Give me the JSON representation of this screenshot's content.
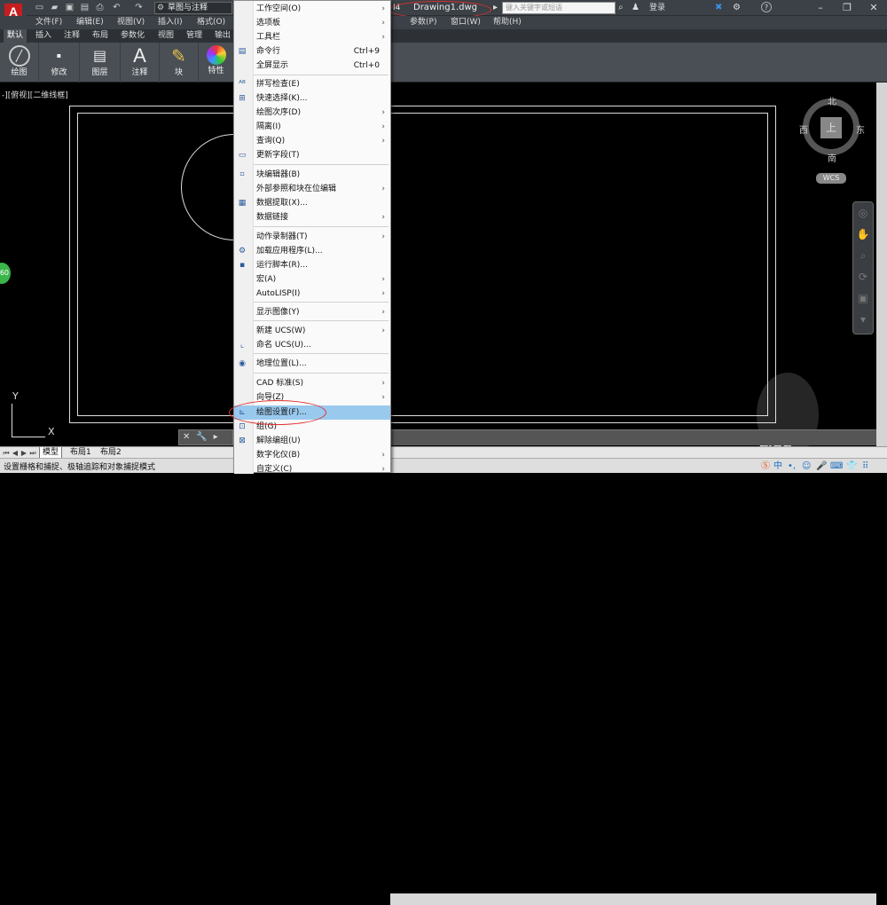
{
  "title_bar": {
    "app_logo": "A",
    "workspace": "草图与注释",
    "doc_number": "I4",
    "doc_title": "Drawing1.dwg",
    "search_placeholder": "键入关键字或短语",
    "login": "登录",
    "help_icon": "?"
  },
  "menubar": {
    "items": [
      "文件(F)",
      "编辑(E)",
      "视图(V)",
      "插入(I)",
      "格式(O)",
      "参数(P)",
      "窗口(W)",
      "帮助(H)"
    ]
  },
  "ribbon_tabs": [
    "默认",
    "插入",
    "注释",
    "布局",
    "参数化",
    "视图",
    "管理",
    "输出"
  ],
  "ribbon_buttons": [
    {
      "label": "绘图",
      "icon": "draw-icon"
    },
    {
      "label": "修改",
      "icon": "modify-icon"
    },
    {
      "label": "图层",
      "icon": "layer-icon"
    },
    {
      "label": "注释",
      "icon": "annotation-icon"
    },
    {
      "label": "块",
      "icon": "block-icon"
    },
    {
      "label": "特性",
      "icon": "properties-icon"
    }
  ],
  "viewport_label": "-][俯视][二维线框]",
  "viewcube": {
    "north": "北",
    "south": "南",
    "east": "东",
    "west": "西",
    "top": "上",
    "wcs": "WCS"
  },
  "ucs": {
    "x": "X",
    "y": "Y"
  },
  "green_badge": "60",
  "watermark": "aidu",
  "layout_tabs": [
    "模型",
    "布局1",
    "布局2"
  ],
  "status_text": "设置栅格和捕捉、极轴追踪和对象捕捉模式",
  "tray_text": "中",
  "tools_menu": {
    "items": [
      {
        "label": "工作空间(O)",
        "shortcut": "",
        "submenu": true,
        "icon": ""
      },
      {
        "label": "选项板",
        "shortcut": "",
        "submenu": true,
        "icon": ""
      },
      {
        "label": "工具栏",
        "shortcut": "",
        "submenu": true,
        "icon": ""
      },
      {
        "label": "命令行",
        "shortcut": "Ctrl+9",
        "submenu": false,
        "icon": "command-line-icon"
      },
      {
        "label": "全屏显示",
        "shortcut": "Ctrl+0",
        "submenu": false,
        "icon": ""
      },
      {
        "label": "拼写检查(E)",
        "shortcut": "",
        "submenu": false,
        "icon": "spellcheck-icon"
      },
      {
        "label": "快速选择(K)...",
        "shortcut": "",
        "submenu": false,
        "icon": "quick-select-icon"
      },
      {
        "label": "绘图次序(D)",
        "shortcut": "",
        "submenu": true,
        "icon": ""
      },
      {
        "label": "隔离(I)",
        "shortcut": "",
        "submenu": true,
        "icon": ""
      },
      {
        "label": "查询(Q)",
        "shortcut": "",
        "submenu": true,
        "icon": ""
      },
      {
        "label": "更新字段(T)",
        "shortcut": "",
        "submenu": false,
        "icon": "update-field-icon"
      },
      {
        "label": "块编辑器(B)",
        "shortcut": "",
        "submenu": false,
        "icon": "block-editor-icon"
      },
      {
        "label": "外部参照和块在位编辑",
        "shortcut": "",
        "submenu": true,
        "icon": ""
      },
      {
        "label": "数据提取(X)...",
        "shortcut": "",
        "submenu": false,
        "icon": "data-extract-icon"
      },
      {
        "label": "数据链接",
        "shortcut": "",
        "submenu": true,
        "icon": ""
      },
      {
        "label": "动作录制器(T)",
        "shortcut": "",
        "submenu": true,
        "icon": ""
      },
      {
        "label": "加载应用程序(L)...",
        "shortcut": "",
        "submenu": false,
        "icon": "load-app-icon"
      },
      {
        "label": "运行脚本(R)...",
        "shortcut": "",
        "submenu": false,
        "icon": "run-script-icon"
      },
      {
        "label": "宏(A)",
        "shortcut": "",
        "submenu": true,
        "icon": ""
      },
      {
        "label": "AutoLISP(I)",
        "shortcut": "",
        "submenu": true,
        "icon": ""
      },
      {
        "label": "显示图像(Y)",
        "shortcut": "",
        "submenu": true,
        "icon": ""
      },
      {
        "label": "新建 UCS(W)",
        "shortcut": "",
        "submenu": true,
        "icon": ""
      },
      {
        "label": "命名 UCS(U)...",
        "shortcut": "",
        "submenu": false,
        "icon": "named-ucs-icon"
      },
      {
        "label": "地理位置(L)...",
        "shortcut": "",
        "submenu": false,
        "icon": "geolocation-icon"
      },
      {
        "label": "CAD 标准(S)",
        "shortcut": "",
        "submenu": true,
        "icon": ""
      },
      {
        "label": "向导(Z)",
        "shortcut": "",
        "submenu": true,
        "icon": ""
      },
      {
        "label": "绘图设置(F)...",
        "shortcut": "",
        "submenu": false,
        "icon": "drafting-settings-icon"
      },
      {
        "label": "组(G)",
        "shortcut": "",
        "submenu": false,
        "icon": "group-icon"
      },
      {
        "label": "解除编组(U)",
        "shortcut": "",
        "submenu": false,
        "icon": "ungroup-icon"
      },
      {
        "label": "数字化仪(B)",
        "shortcut": "",
        "submenu": true,
        "icon": ""
      },
      {
        "label": "自定义(C)",
        "shortcut": "",
        "submenu": true,
        "icon": ""
      }
    ],
    "highlighted": "绘图设置(F)..."
  }
}
